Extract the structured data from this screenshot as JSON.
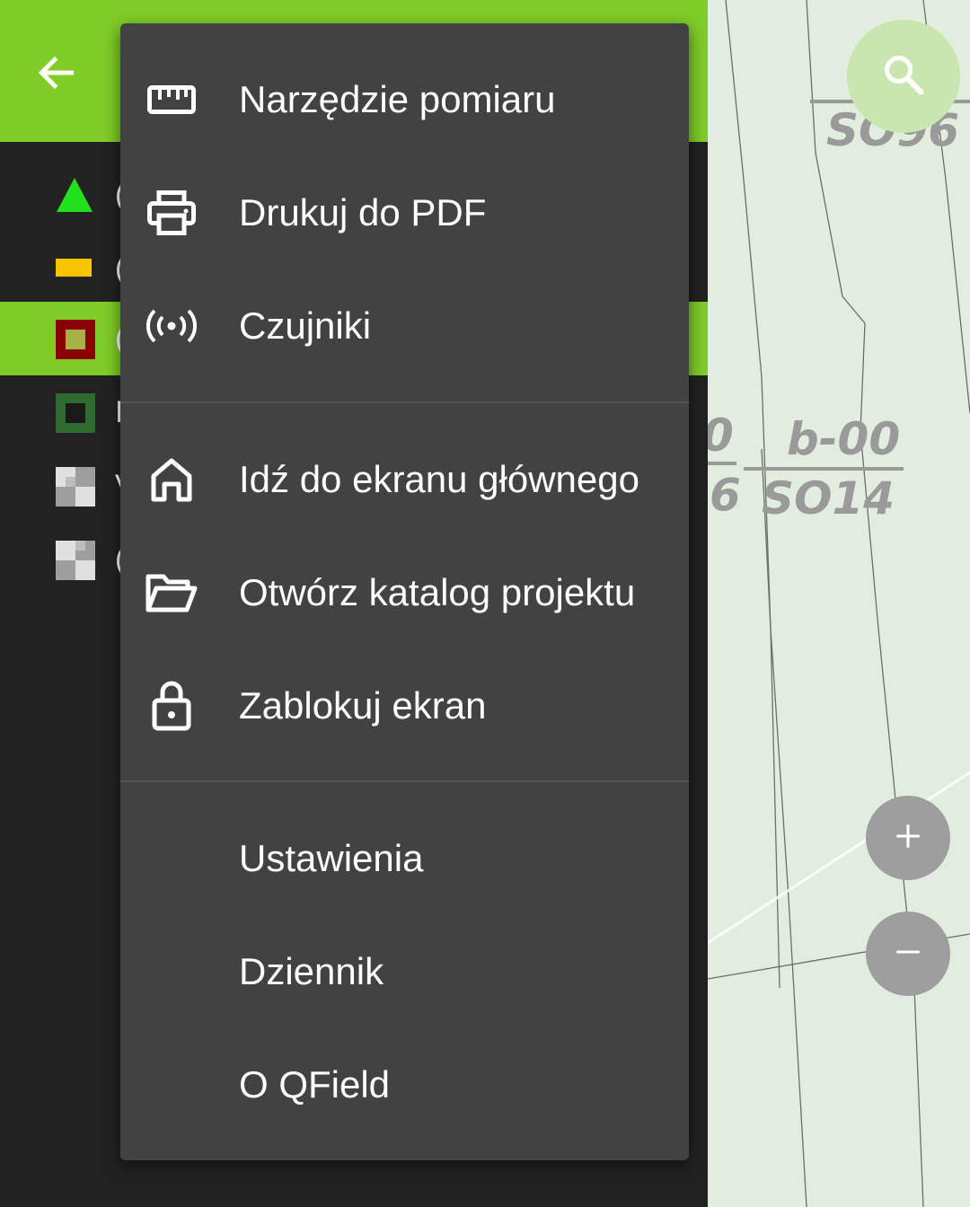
{
  "map": {
    "labels": [
      "SO96",
      "b-00",
      "SO14",
      "0",
      "6"
    ]
  },
  "search": {
    "icon": "search-icon"
  },
  "zoom": {
    "in_icon": "plus-icon",
    "out_icon": "minus-icon"
  },
  "colors": {
    "accent_green": "#80cc28",
    "menu_bg": "#424242",
    "panel_bg": "#222222",
    "map_bg": "#e2ede0"
  },
  "sidebar": {
    "back_icon": "arrow-left-icon",
    "layers": [
      {
        "icon": "triangle-green-icon",
        "name": "("
      },
      {
        "icon": "yellow-line-icon",
        "name": "("
      },
      {
        "icon": "red-square-icon",
        "name": "(",
        "selected": true
      },
      {
        "icon": "dark-green-square-icon",
        "name": "I"
      },
      {
        "icon": "raster-icon",
        "name": "V"
      },
      {
        "icon": "raster-icon",
        "name": "("
      }
    ]
  },
  "menu": {
    "items": [
      {
        "label": "Narzędzie pomiaru",
        "icon": "ruler-icon"
      },
      {
        "label": "Drukuj do PDF",
        "icon": "printer-icon"
      },
      {
        "label": "Czujniki",
        "icon": "sensor-icon"
      },
      {
        "label": "Idź do ekranu głównego",
        "icon": "home-icon"
      },
      {
        "label": "Otwórz katalog projektu",
        "icon": "folder-open-icon"
      },
      {
        "label": "Zablokuj ekran",
        "icon": "lock-icon"
      },
      {
        "label": "Ustawienia",
        "icon": ""
      },
      {
        "label": "Dziennik",
        "icon": ""
      },
      {
        "label": "O QField",
        "icon": ""
      }
    ]
  }
}
